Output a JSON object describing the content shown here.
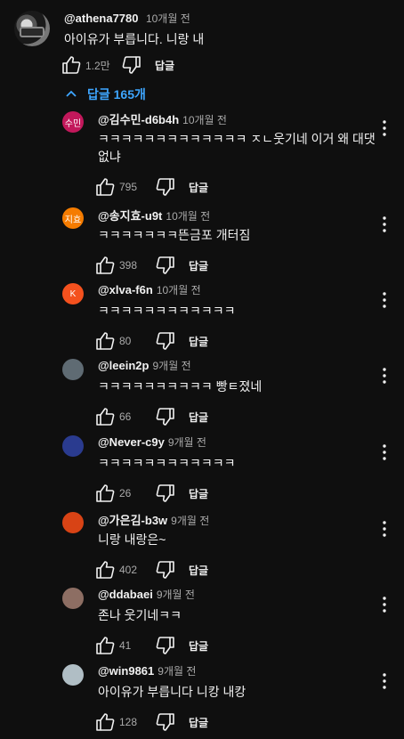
{
  "thread": {
    "author": "@athena7780",
    "time": "10개월 전",
    "text": "아이유가 부릅니다. 니랑 내",
    "likes": "1.2만",
    "reply_label": "답글",
    "replies_toggle": "답글 165개"
  },
  "replies": [
    {
      "author": "@김수민-d6b4h",
      "time": "10개월 전",
      "lines": [
        "ㅋㅋㅋㅋㅋㅋㅋㅋㅋㅋㅋㅋㅋ ㅈㄴ웃기네 이거 왜 대댓",
        "없냐"
      ],
      "likes": "795",
      "reply_label": "답글",
      "avatar_text": "수민",
      "avatar_color": "#c2185b"
    },
    {
      "author": "@송지효-u9t",
      "time": "10개월 전",
      "lines": [
        "ㅋㅋㅋㅋㅋㅋㅋ뜬금포 개터짐"
      ],
      "likes": "398",
      "reply_label": "답글",
      "avatar_text": "지효",
      "avatar_color": "#f57c00"
    },
    {
      "author": "@xlva-f6n",
      "time": "10개월 전",
      "lines": [
        "ㅋㅋㅋㅋㅋㅋㅋㅋㅋㅋㅋㅋ"
      ],
      "likes": "80",
      "reply_label": "답글",
      "avatar_text": "K",
      "avatar_color": "#f4511e"
    },
    {
      "author": "@leein2p",
      "time": "9개월 전",
      "lines": [
        "ㅋㅋㅋㅋㅋㅋㅋㅋㅋㅋ 빵ㅌ졌네"
      ],
      "likes": "66",
      "reply_label": "답글",
      "avatar_text": "",
      "avatar_color": "#5f6b73"
    },
    {
      "author": "@Never-c9y",
      "time": "9개월 전",
      "lines": [
        "ㅋㅋㅋㅋㅋㅋㅋㅋㅋㅋㅋㅋ"
      ],
      "likes": "26",
      "reply_label": "답글",
      "avatar_text": "",
      "avatar_color": "#2a3b8f"
    },
    {
      "author": "@가은김-b3w",
      "time": "9개월 전",
      "lines": [
        "니랑 내랑은~"
      ],
      "likes": "402",
      "reply_label": "답글",
      "avatar_text": "",
      "avatar_color": "#d84315"
    },
    {
      "author": "@ddabaei",
      "time": "9개월 전",
      "lines": [
        "존나 웃기네ㅋㅋ"
      ],
      "likes": "41",
      "reply_label": "답글",
      "avatar_text": "",
      "avatar_color": "#8d6e63"
    },
    {
      "author": "@win9861",
      "time": "9개월 전",
      "lines": [
        "아이유가 부릅니다 니캉 내캉"
      ],
      "likes": "128",
      "reply_label": "답글",
      "avatar_text": "",
      "avatar_color": "#b0bec5"
    }
  ],
  "icons": {
    "like": "thumb-up-icon",
    "dislike": "thumb-down-icon",
    "more": "more-vertical-icon",
    "toggle": "chevron-up-icon"
  }
}
